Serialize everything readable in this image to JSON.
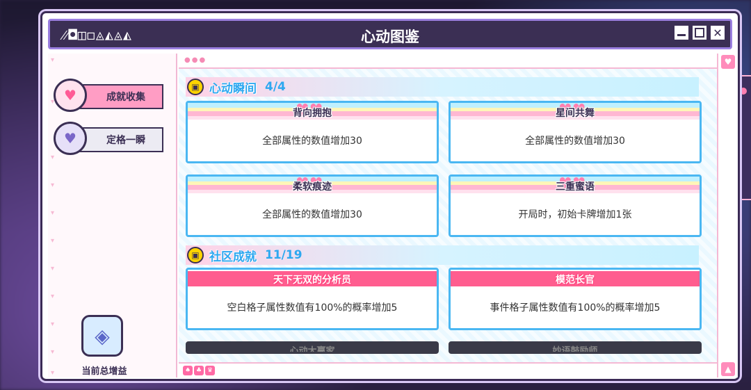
{
  "window": {
    "title_glyphs": "⁄⁄◘◫◻◬◭◬◭",
    "title": "心动图鉴"
  },
  "nav": {
    "items": [
      {
        "label": "成就收集",
        "active": true
      },
      {
        "label": "定格一瞬",
        "active": false
      }
    ]
  },
  "bonus": {
    "label": "当前总增益"
  },
  "sections": [
    {
      "title": "心动瞬间",
      "count": "4/4",
      "cards": [
        {
          "name": "背向拥抱",
          "desc": "全部属性的数值增加30"
        },
        {
          "name": "星间共舞",
          "desc": "全部属性的数值增加30"
        },
        {
          "name": "柔软痕迹",
          "desc": "全部属性的数值增加30"
        },
        {
          "name": "三重蜜语",
          "desc": "开局时，初始卡牌增加1张"
        }
      ]
    },
    {
      "title": "社区成就",
      "count": "11/19",
      "cards": [
        {
          "name": "天下无双的分析员",
          "desc": "空白格子属性数值有100%的概率增加5"
        },
        {
          "name": "模范长官",
          "desc": "事件格子属性数值有100%的概率增加5"
        },
        {
          "name": "心动大赢家",
          "desc": ""
        },
        {
          "name": "妙语鼓励师",
          "desc": ""
        }
      ]
    }
  ],
  "colors": {
    "accent_pink": "#ff5d8f",
    "accent_blue": "#4ab7f2",
    "dark": "#3b2f54"
  }
}
